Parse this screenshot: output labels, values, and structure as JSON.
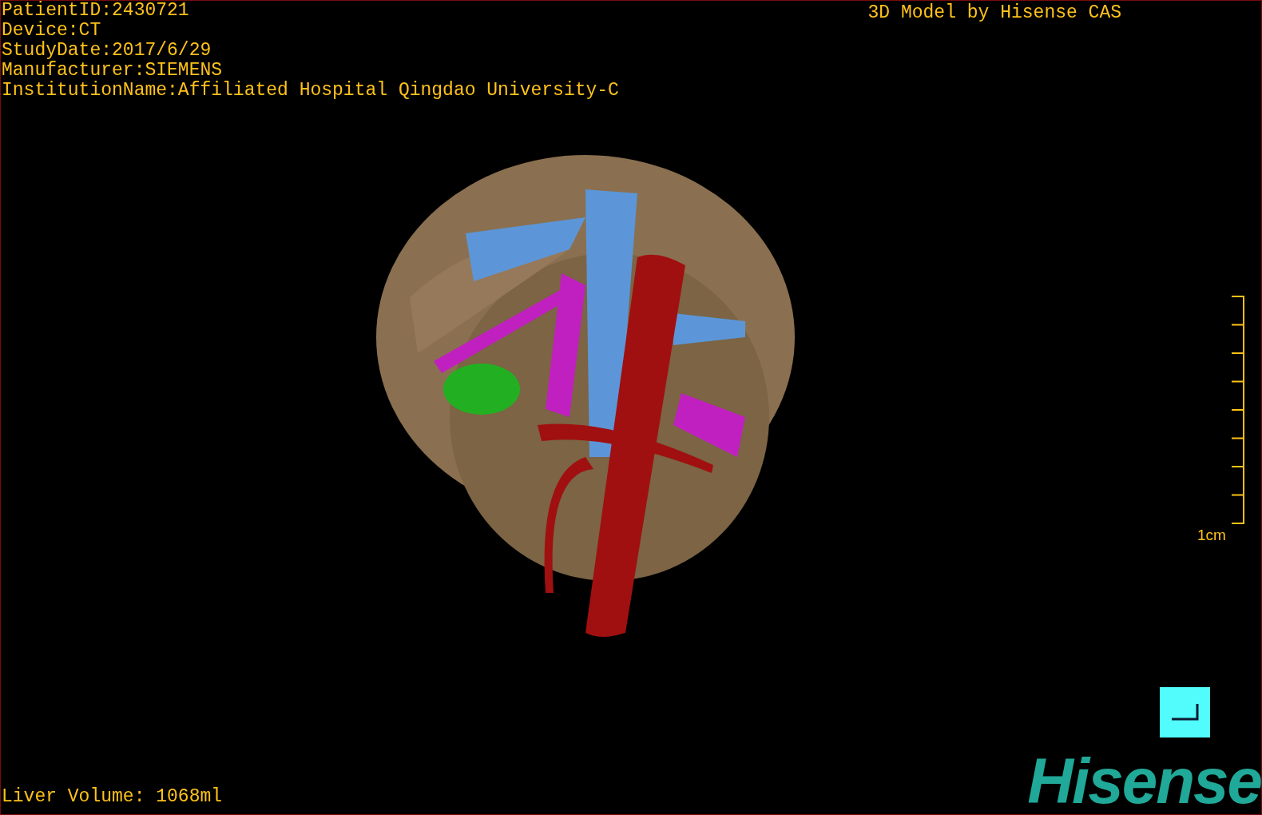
{
  "info_lines": [
    "PatientID:2430721",
    "Device:CT",
    "StudyDate:2017/6/29",
    "Manufacturer:SIEMENS",
    "InstitutionName:Affiliated Hospital Qingdao University-C"
  ],
  "title": "3D Model by Hisense CAS",
  "scale_bar": {
    "label": "1cm"
  },
  "liver_volume": "Liver Volume: 1068ml",
  "logo": "Hisense"
}
